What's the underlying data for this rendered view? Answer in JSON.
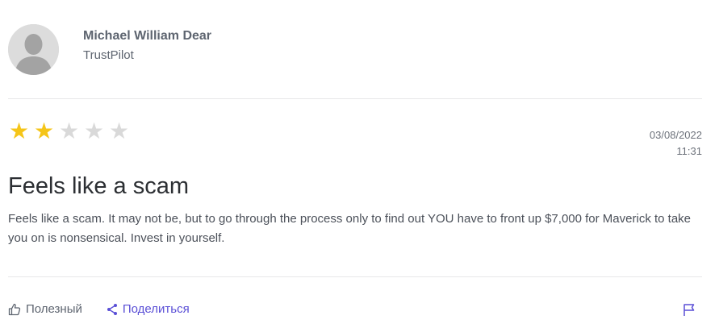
{
  "review": {
    "author_name": "Michael William Dear",
    "source": "TrustPilot",
    "rating": 2,
    "max_rating": 5,
    "date": "03/08/2022",
    "time": "11:31",
    "title": "Feels like a scam",
    "body": "Feels like a scam. It may not be, but to go through the process only to find out YOU have to front up $7,000 for Maverick to take you on is nonsensical. Invest in yourself."
  },
  "actions": {
    "helpful_label": "Полезный",
    "share_label": "Поделиться"
  },
  "icons": {
    "avatar": "user-avatar-placeholder",
    "helpful": "thumbs-up-icon",
    "share": "share-icon",
    "flag": "flag-icon",
    "star": "star-icon"
  },
  "colors": {
    "star_filled": "#f5c518",
    "star_empty": "#d9d9d9",
    "accent": "#5a4fd6"
  }
}
